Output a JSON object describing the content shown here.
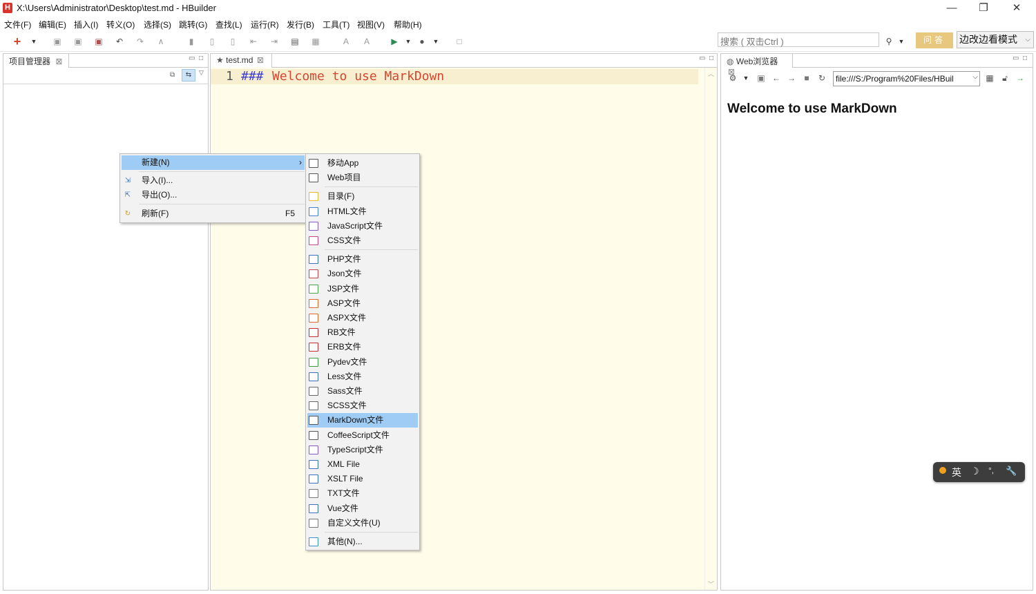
{
  "window": {
    "title": "X:\\Users\\Administrator\\Desktop\\test.md  -  HBuilder",
    "logo_letter": "H",
    "minimize": "—",
    "restore": "❐",
    "close": "✕"
  },
  "menubar": [
    "文件(F)",
    "编辑(E)",
    "插入(I)",
    "转义(O)",
    "选择(S)",
    "跳转(G)",
    "查找(L)",
    "运行(R)",
    "发行(B)",
    "工具(T)",
    "视图(V)",
    "帮助(H)"
  ],
  "toolbar": {
    "search_placeholder": "搜索 ( 双击Ctrl )",
    "ask_button": "问答",
    "mode_button": "边改边看模式"
  },
  "project_panel": {
    "tab_label": "项目管理器"
  },
  "editor": {
    "tab_label": "test.md",
    "line_number": "1",
    "code_hash": "###",
    "code_text": "Welcome to use MarkDown"
  },
  "browser_panel": {
    "tab_label": "Web浏览器",
    "url": "file:///S:/Program%20Files/HBuil",
    "page_heading": "Welcome to use MarkDown"
  },
  "context_menu": {
    "items": [
      {
        "label": "新建(N)",
        "submenu_arrow": "›",
        "highlighted": true
      },
      {
        "label": "导入(I)..."
      },
      {
        "label": "导出(O)..."
      },
      {
        "label": "刷新(F)",
        "accelerator": "F5"
      }
    ]
  },
  "submenu": {
    "items": [
      {
        "label": "移动App",
        "icon": "app-icon",
        "color": "#555555"
      },
      {
        "label": "Web项目",
        "icon": "web-icon",
        "color": "#555555"
      },
      {
        "label": "目录(F)",
        "icon": "folder-icon",
        "color": "#e9b93d"
      },
      {
        "label": "HTML文件",
        "icon": "html-file-icon",
        "color": "#4a7fd0"
      },
      {
        "label": "JavaScript文件",
        "icon": "js-file-icon",
        "color": "#8a58c6"
      },
      {
        "label": "CSS文件",
        "icon": "css-file-icon",
        "color": "#c64a8a"
      },
      {
        "label": "PHP文件",
        "icon": "php-file-icon",
        "color": "#3a6fc4"
      },
      {
        "label": "Json文件",
        "icon": "json-file-icon",
        "color": "#c24848"
      },
      {
        "label": "JSP文件",
        "icon": "jsp-file-icon",
        "color": "#4aa34a"
      },
      {
        "label": "ASP文件",
        "icon": "asp-file-icon",
        "color": "#e06a28"
      },
      {
        "label": "ASPX文件",
        "icon": "aspx-file-icon",
        "color": "#e06a28"
      },
      {
        "label": "RB文件",
        "icon": "rb-file-icon",
        "color": "#c83030"
      },
      {
        "label": "ERB文件",
        "icon": "erb-file-icon",
        "color": "#c83030"
      },
      {
        "label": "Pydev文件",
        "icon": "pydev-file-icon",
        "color": "#3ca040"
      },
      {
        "label": "Less文件",
        "icon": "less-file-icon",
        "color": "#3a6fc4"
      },
      {
        "label": "Sass文件",
        "icon": "sass-file-icon",
        "color": "#666666"
      },
      {
        "label": "SCSS文件",
        "icon": "scss-file-icon",
        "color": "#666666"
      },
      {
        "label": "MarkDown文件",
        "icon": "markdown-file-icon",
        "color": "#555555",
        "highlighted": true
      },
      {
        "label": "CoffeeScript文件",
        "icon": "coffeescript-file-icon",
        "color": "#555555"
      },
      {
        "label": "TypeScript文件",
        "icon": "typescript-file-icon",
        "color": "#8a58c6"
      },
      {
        "label": "XML File",
        "icon": "xml-file-icon",
        "color": "#3a6fc4"
      },
      {
        "label": "XSLT File",
        "icon": "xslt-file-icon",
        "color": "#3a6fc4"
      },
      {
        "label": "TXT文件",
        "icon": "txt-file-icon",
        "color": "#777777"
      },
      {
        "label": "Vue文件",
        "icon": "vue-file-icon",
        "color": "#3a6fc4"
      },
      {
        "label": "自定义文件(U)",
        "icon": "custom-file-icon",
        "color": "#777777"
      },
      {
        "label": "其他(N)...",
        "icon": "other-icon",
        "color": "#3a8fd0"
      }
    ]
  },
  "ime": {
    "lang": "英",
    "moon": "☽",
    "punct": "°,",
    "tool": "🔧"
  }
}
